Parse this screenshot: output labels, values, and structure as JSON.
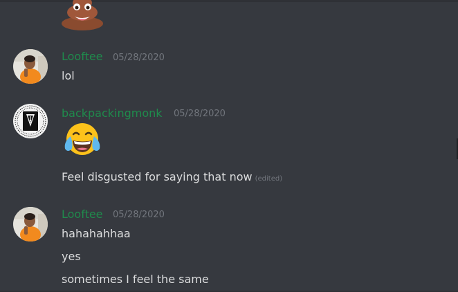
{
  "messages": [
    {
      "author": "Looftee",
      "timestamp": "05/28/2020",
      "avatar_icon": "person-photo-avatar",
      "lines": [
        "lol"
      ]
    },
    {
      "author": "backpackingmonk",
      "timestamp": "05/28/2020",
      "avatar_icon": "pen-nib-logo-avatar",
      "emoji": "face-with-tears-of-joy",
      "lines": [
        "Feel disgusted for saying that now"
      ],
      "edited_label": "(edited)"
    },
    {
      "author": "Looftee",
      "timestamp": "05/28/2020",
      "avatar_icon": "person-photo-avatar",
      "lines": [
        "hahahahhaa",
        "yes",
        "sometimes I feel the same"
      ]
    }
  ],
  "top_emoji": "pile-of-poo",
  "colors": {
    "background": "#36393f",
    "username": "#1f8b4c",
    "timestamp": "#72767d",
    "message_text": "#dcddde"
  }
}
